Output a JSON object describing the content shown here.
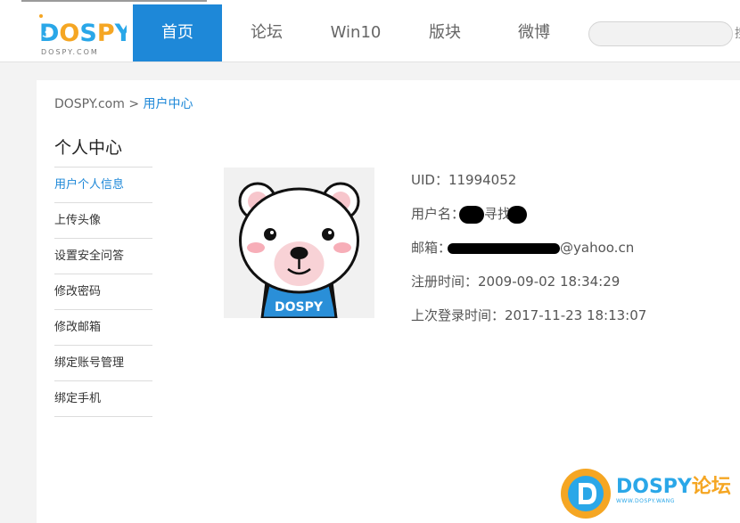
{
  "header": {
    "logo_text": "DOSPY",
    "logo_sub": "DOSPY.COM",
    "nav": [
      {
        "label": "首页",
        "active": true
      },
      {
        "label": "论坛",
        "active": false
      },
      {
        "label": "Win10",
        "active": false
      },
      {
        "label": "版块",
        "active": false
      },
      {
        "label": "微博",
        "active": false
      }
    ],
    "search_placeholder": "",
    "search_cut_glyph": "搜"
  },
  "breadcrumb": {
    "root": "DOSPY.com",
    "separator": ">",
    "current": "用户中心"
  },
  "sidebar": {
    "title": "个人中心",
    "items": [
      {
        "label": "用户个人信息",
        "active": true
      },
      {
        "label": "上传头像",
        "active": false
      },
      {
        "label": "设置安全问答",
        "active": false
      },
      {
        "label": "修改密码",
        "active": false
      },
      {
        "label": "修改邮箱",
        "active": false
      },
      {
        "label": "绑定账号管理",
        "active": false
      },
      {
        "label": "绑定手机",
        "active": false
      }
    ]
  },
  "avatar": {
    "shirt_text": "DOSPY"
  },
  "profile": {
    "uid_label": "UID：",
    "uid_value": "11994052",
    "username_label": "用户名：",
    "username_visible": "寻找",
    "email_label": "邮箱：",
    "email_suffix": "@yahoo.cn",
    "register_label": "注册时间：",
    "register_value": "2009-09-02 18:34:29",
    "last_login_label": "上次登录时间：",
    "last_login_value": "2017-11-23 18:13:07"
  },
  "watermark": {
    "brand": "DOSPY",
    "brand_cn": "论坛",
    "url_text": "WWW.DOSPY.WANG"
  },
  "colors": {
    "accent": "#1e88d8",
    "page_bg": "#f3f3f3",
    "redaction": "#000000"
  }
}
